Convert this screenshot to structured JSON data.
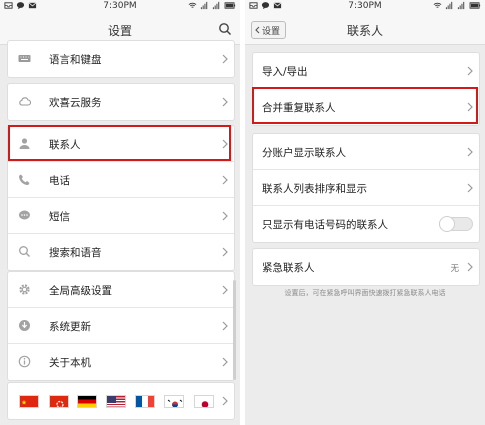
{
  "status": {
    "time": "7:30PM",
    "left_icons": [
      "inbox-icon",
      "chat-icon",
      "mail-icon"
    ],
    "right_icons": [
      "wifi-icon",
      "signal-icon",
      "signal-icon",
      "battery-icon"
    ]
  },
  "left": {
    "title": "设置",
    "groups": [
      {
        "items": [
          {
            "label": "语言和键盘",
            "icon": "keyboard-icon"
          }
        ]
      },
      {
        "items": [
          {
            "label": "欢喜云服务",
            "icon": "cloud-icon"
          }
        ]
      },
      {
        "items": [
          {
            "label": "联系人",
            "icon": "contact-icon",
            "highlighted": true
          },
          {
            "label": "电话",
            "icon": "phone-icon"
          },
          {
            "label": "短信",
            "icon": "sms-icon"
          },
          {
            "label": "搜索和语音",
            "icon": "search-icon"
          }
        ]
      },
      {
        "items": [
          {
            "label": "全局高级设置",
            "icon": "gear-icon"
          },
          {
            "label": "系统更新",
            "icon": "download-icon"
          },
          {
            "label": "关于本机",
            "icon": "info-icon"
          }
        ]
      }
    ],
    "flags": [
      "china-flag",
      "hongkong-flag",
      "germany-flag",
      "usa-flag",
      "france-flag",
      "korea-flag",
      "japan-flag"
    ]
  },
  "right": {
    "back_label": "设置",
    "title": "联系人",
    "items": [
      {
        "label": "导入/导出",
        "type": "chevron"
      },
      {
        "label": "合并重复联系人",
        "type": "chevron",
        "highlighted": true
      },
      {
        "label": "分账户显示联系人",
        "type": "chevron"
      },
      {
        "label": "联系人列表排序和显示",
        "type": "chevron"
      },
      {
        "label": "只显示有电话号码的联系人",
        "type": "toggle",
        "toggle_on": false
      },
      {
        "label": "紧急联系人",
        "type": "value",
        "value": "无"
      }
    ],
    "note": "设置后，可在紧急呼叫界面快速拨打紧急联系人电话"
  },
  "colors": {
    "highlight": "#d11a1a",
    "background": "#ececec",
    "card": "#ffffff",
    "text": "#222222"
  }
}
